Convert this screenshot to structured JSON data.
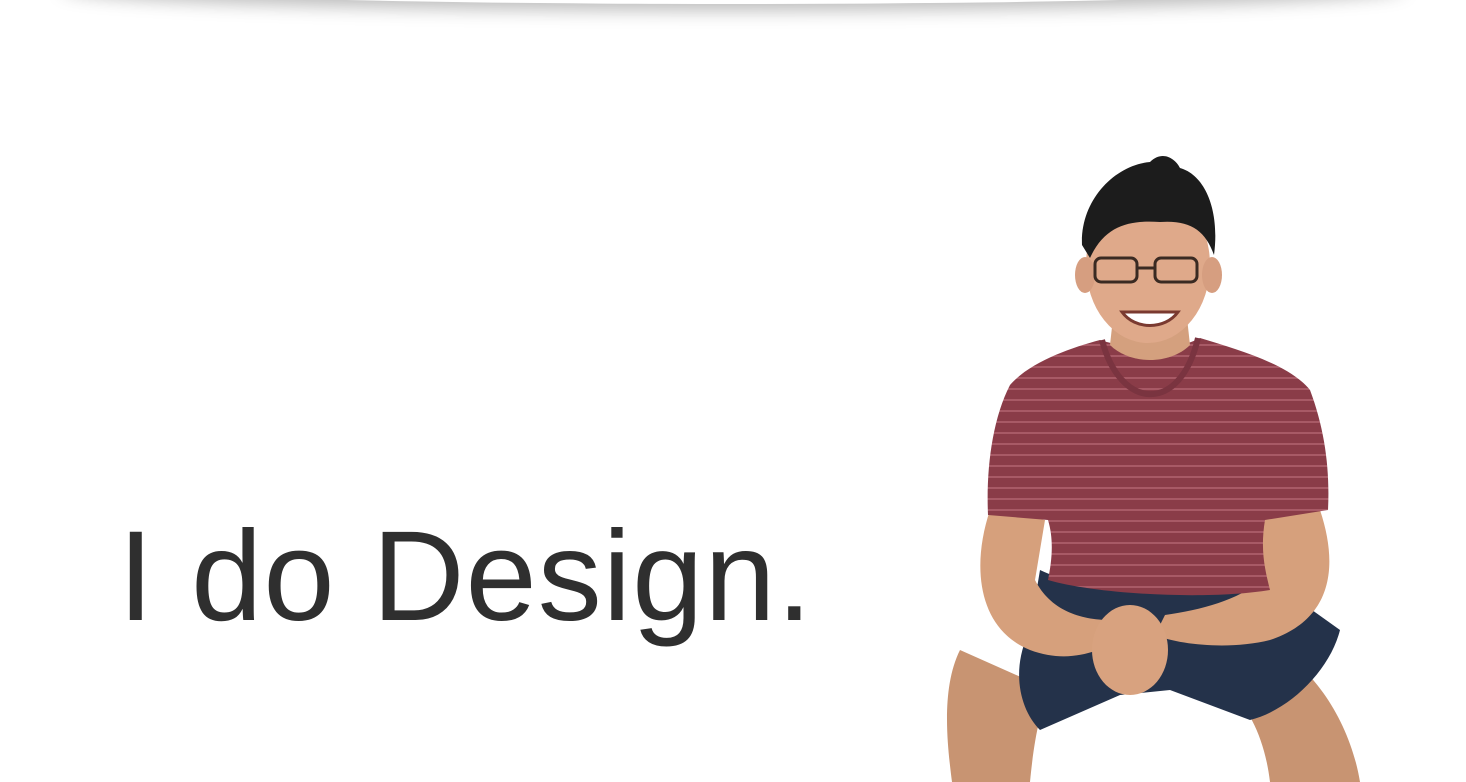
{
  "hero": {
    "headline": "I do Design."
  },
  "portrait": {
    "description_icon": "person-photo"
  },
  "colors": {
    "background": "#ffffff",
    "text": "#2f2f2f",
    "shirt": "#8a3c48",
    "shirt_stripe": "#a85a66",
    "shorts": "#24324a",
    "skin": "#d9a27f",
    "hair": "#1c1c1c"
  }
}
